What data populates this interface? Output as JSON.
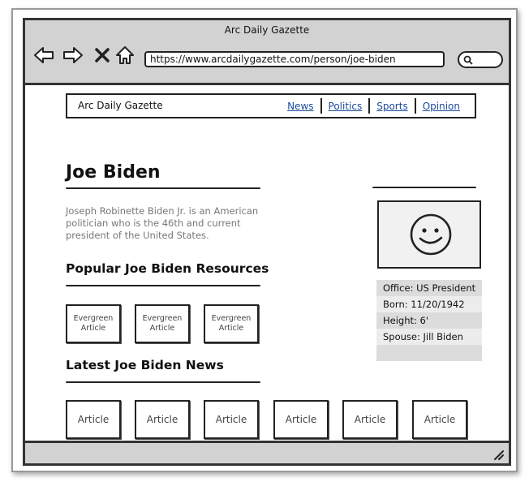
{
  "window": {
    "title": "Arc Daily Gazette"
  },
  "browser": {
    "url": "https://www.arcdailygazette.com/person/joe-biden"
  },
  "site": {
    "name": "Arc Daily Gazette",
    "nav": [
      "News",
      "Politics",
      "Sports",
      "Opinion"
    ]
  },
  "person": {
    "name": "Joe Biden",
    "bio": "Joseph Robinette Biden Jr. is an American politician who is the 46th and current president of the United States.",
    "facts": [
      "Office: US President",
      "Born: 11/20/1942",
      "Height: 6'",
      "Spouse: Jill Biden",
      ""
    ]
  },
  "resources": {
    "title": "Popular Joe Biden Resources",
    "cards": [
      "Evergreen Article",
      "Evergreen Article",
      "Evergreen Article"
    ]
  },
  "news": {
    "title": "Latest Joe Biden News",
    "cards": [
      "Article",
      "Article",
      "Article",
      "Article",
      "Article",
      "Article"
    ]
  },
  "icons": {
    "back": "back-arrow-icon",
    "forward": "forward-arrow-icon",
    "stop": "close-icon",
    "home": "home-icon",
    "search": "search-icon",
    "photo": "smiley-face-icon",
    "resize": "resize-grip-icon"
  },
  "colors": {
    "link": "#1a4a9a",
    "chrome": "#d2d2d2",
    "fact_dark": "#dcdcdc",
    "fact_light": "#ececec"
  }
}
